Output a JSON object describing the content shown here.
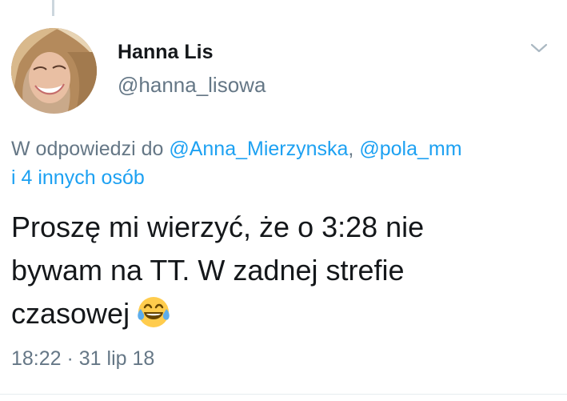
{
  "tweet": {
    "author": {
      "display_name": "Hanna Lis",
      "handle": "@hanna_lisowa"
    },
    "reply_context": {
      "prefix": "W odpowiedzi do ",
      "mentions": [
        "@Anna_Mierzynska",
        "@pola_mm"
      ],
      "separator": ", ",
      "others": "i 4 innych osób"
    },
    "text_lines": [
      "Proszę mi wierzyć, że o 3:28 nie",
      "bywam na TT. W zadnej strefie",
      "czasowej"
    ],
    "emoji": "face-with-tears-of-joy",
    "time": "18:22",
    "dot": " · ",
    "date": "31 lip 18"
  },
  "icons": {
    "menu": "chevron-down-icon",
    "thread": "thread-connector"
  },
  "colors": {
    "text": "#14171a",
    "secondary": "#657786",
    "link": "#1da1f2",
    "border": "#e6ecf0",
    "thread_line": "#ccd6dd"
  }
}
